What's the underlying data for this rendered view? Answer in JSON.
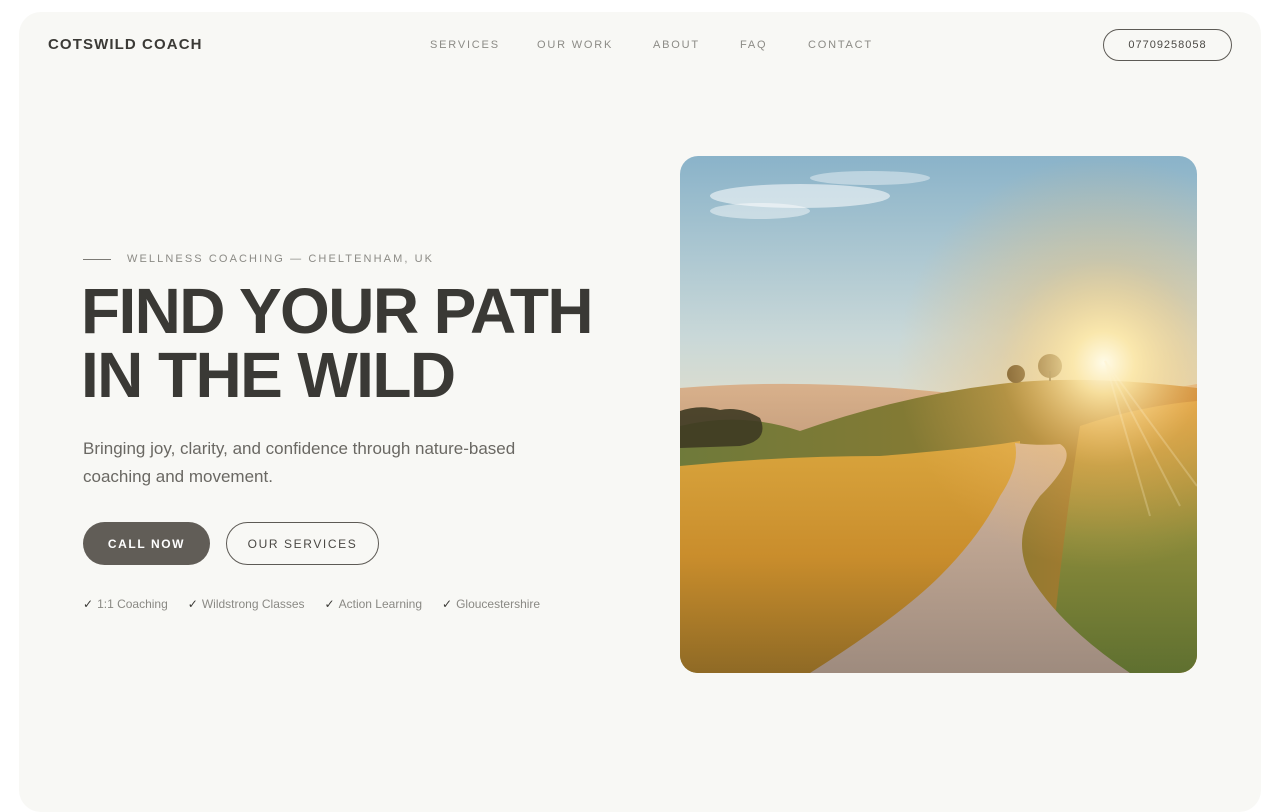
{
  "brand": {
    "name": "COTSWILD COACH"
  },
  "nav": {
    "items": [
      {
        "label": "SERVICES"
      },
      {
        "label": "OUR WORK"
      },
      {
        "label": "ABOUT"
      },
      {
        "label": "FAQ"
      },
      {
        "label": "CONTACT"
      }
    ],
    "phone": "07709258058"
  },
  "hero": {
    "eyebrow": "WELLNESS COACHING — CHELTENHAM, UK",
    "headline_line1": "FIND YOUR PATH",
    "headline_line2": "IN THE WILD",
    "lead": "Bringing joy, clarity, and confidence through nature-based coaching and movement.",
    "primary_cta": "CALL NOW",
    "secondary_cta": "OUR SERVICES",
    "features": [
      {
        "check": "✓",
        "label": "1:1 Coaching"
      },
      {
        "check": "✓",
        "label": "Wildstrong Classes"
      },
      {
        "check": "✓",
        "label": "Action Learning"
      },
      {
        "check": "✓",
        "label": "Gloucestershire"
      }
    ],
    "image_subject": "winding country path through golden grass hills at sunset"
  },
  "colors": {
    "page_bg": "#f8f8f5",
    "text_dark": "#3a3935",
    "text_muted": "#8c8b86",
    "primary_button": "#615d57"
  }
}
